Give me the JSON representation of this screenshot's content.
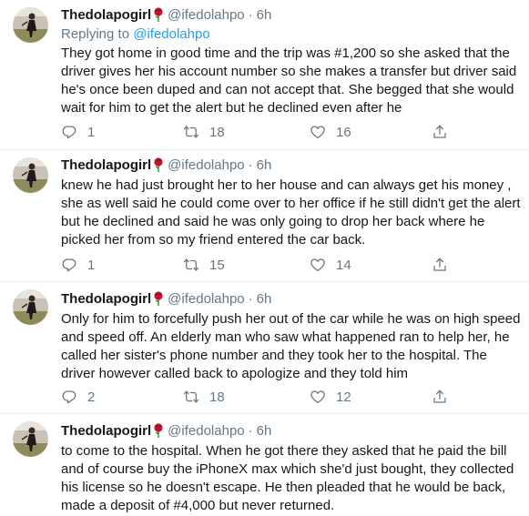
{
  "tweets": [
    {
      "name": "Thedolapogirl",
      "handle": "@ifedolahpo",
      "time": "6h",
      "replying_prefix": "Replying to ",
      "replying_to": "@ifedolahpo",
      "text": "They got home in good time and the trip was #1,200 so she asked that the driver gives her his account number so she makes a transfer but driver said he's once been duped and can not accept that. She begged that she would wait for him to get the alert but he declined even after he",
      "replies": "1",
      "retweets": "18",
      "likes": "16"
    },
    {
      "name": "Thedolapogirl",
      "handle": "@ifedolahpo",
      "time": "6h",
      "text": "knew he had just brought her to her house and can always get his money , she as well said he could come over to her office if he still didn't get the alert but he declined and said he was only  going to drop her back where he picked her from so my  friend entered the car back.",
      "replies": "1",
      "retweets": "15",
      "likes": "14"
    },
    {
      "name": "Thedolapogirl",
      "handle": "@ifedolahpo",
      "time": "6h",
      "text": "Only for him to forcefully push her out of the car while he was on high speed and speed off. An elderly man who saw what happened ran to help her, he called her sister's phone number and they took her to the hospital. The driver however called back to apologize and they told him",
      "replies": "2",
      "retweets": "18",
      "likes": "12"
    },
    {
      "name": "Thedolapogirl",
      "handle": "@ifedolahpo",
      "time": "6h",
      "text": "to come to the hospital. When he got there they asked that he paid the bill and of course buy the iPhoneX max which she'd just bought, they collected his license so he doesn't escape. He then pleaded that he would be back, made a deposit of #4,000 but never returned."
    }
  ],
  "separator": "·",
  "icons": {
    "reply": "reply-icon",
    "retweet": "retweet-icon",
    "like": "like-icon",
    "share": "share-icon",
    "emoji": "rose-emoji-icon"
  },
  "colors": {
    "text": "#14171a",
    "muted": "#657786",
    "link": "#1da1f2",
    "border": "#e6ecf0",
    "rose": "#c0142b"
  }
}
